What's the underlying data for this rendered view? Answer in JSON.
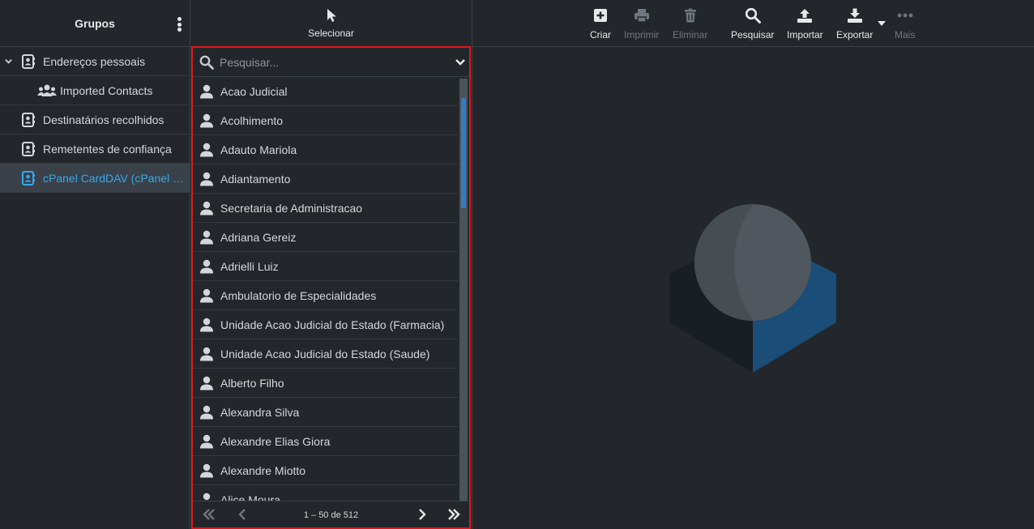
{
  "groups_panel": {
    "title": "Grupos",
    "items": [
      {
        "label": "Endereços pessoais",
        "expanded": true
      },
      {
        "label": "Imported Contacts"
      },
      {
        "label": "Destinatários recolhidos"
      },
      {
        "label": "Remetentes de confiança"
      },
      {
        "label": "cPanel CardDAV (cPanel C...",
        "selected": true
      }
    ]
  },
  "contacts_panel": {
    "select_label": "Selecionar",
    "search_placeholder": "Pesquisar...",
    "contacts": [
      "Acao Judicial",
      "Acolhimento",
      "Adauto Mariola",
      "Adiantamento",
      "Secretaria de Administracao",
      "Adriana Gereiz",
      "Adrielli Luiz",
      "Ambulatorio de Especialidades",
      "Unidade Acao Judicial do Estado (Farmacia)",
      "Unidade Acao Judicial do Estado (Saude)",
      "Alberto Filho",
      "Alexandra Silva",
      "Alexandre Elias Giora",
      "Alexandre Miotto",
      "Alice Moura"
    ],
    "pagination": "1 – 50 de 512"
  },
  "toolbar": {
    "create": "Criar",
    "print": "Imprimir",
    "delete": "Eliminar",
    "search": "Pesquisar",
    "import": "Importar",
    "export": "Exportar",
    "more": "Mais"
  },
  "colors": {
    "background": "#23272b",
    "accent": "#33a8f0",
    "highlight_border": "#e0161e"
  }
}
